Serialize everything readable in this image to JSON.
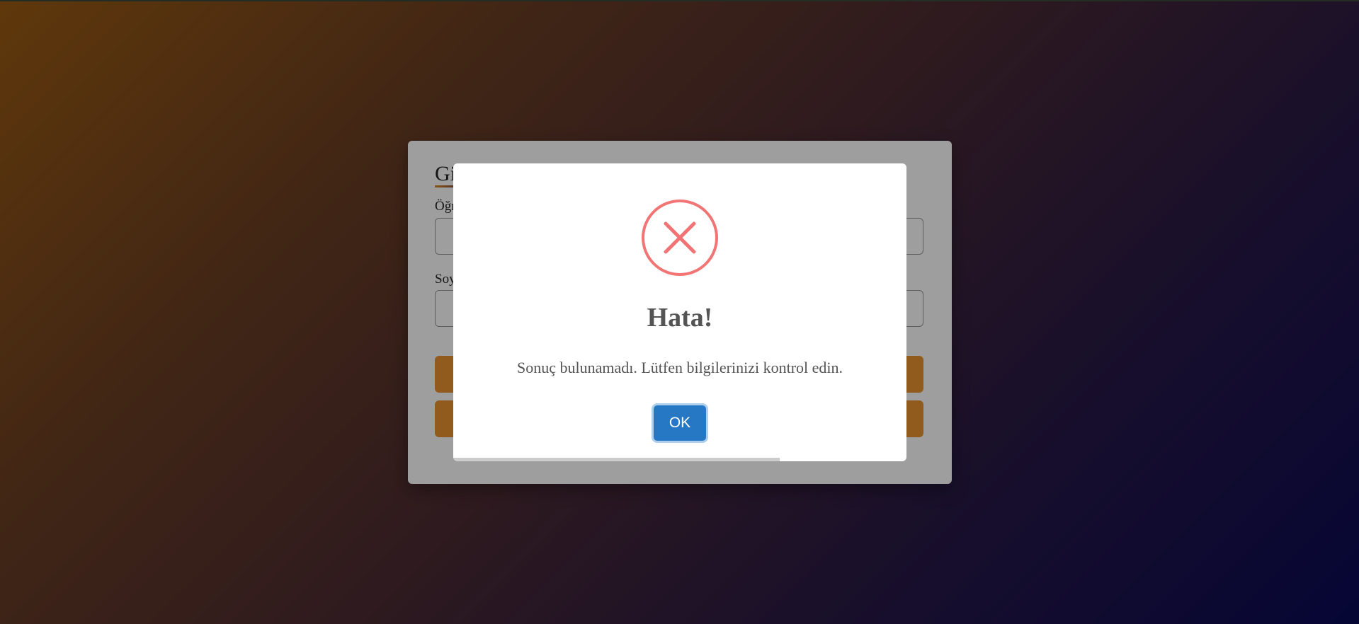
{
  "background_card": {
    "title": "Giriş",
    "field1_label": "Öğrenci No",
    "field2_label": "Soyadı"
  },
  "modal": {
    "icon": "error-x-icon",
    "title": "Hata!",
    "message": "Sonuç bulunamadı. Lütfen bilgilerinizi kontrol edin.",
    "confirm_label": "OK",
    "timer_progress": 0.72
  },
  "colors": {
    "error": "#f27474",
    "confirm_button": "#2778c4",
    "card_button": "#e8932e",
    "gradient_start": "#9a5a12",
    "gradient_end": "#0a0a55"
  }
}
